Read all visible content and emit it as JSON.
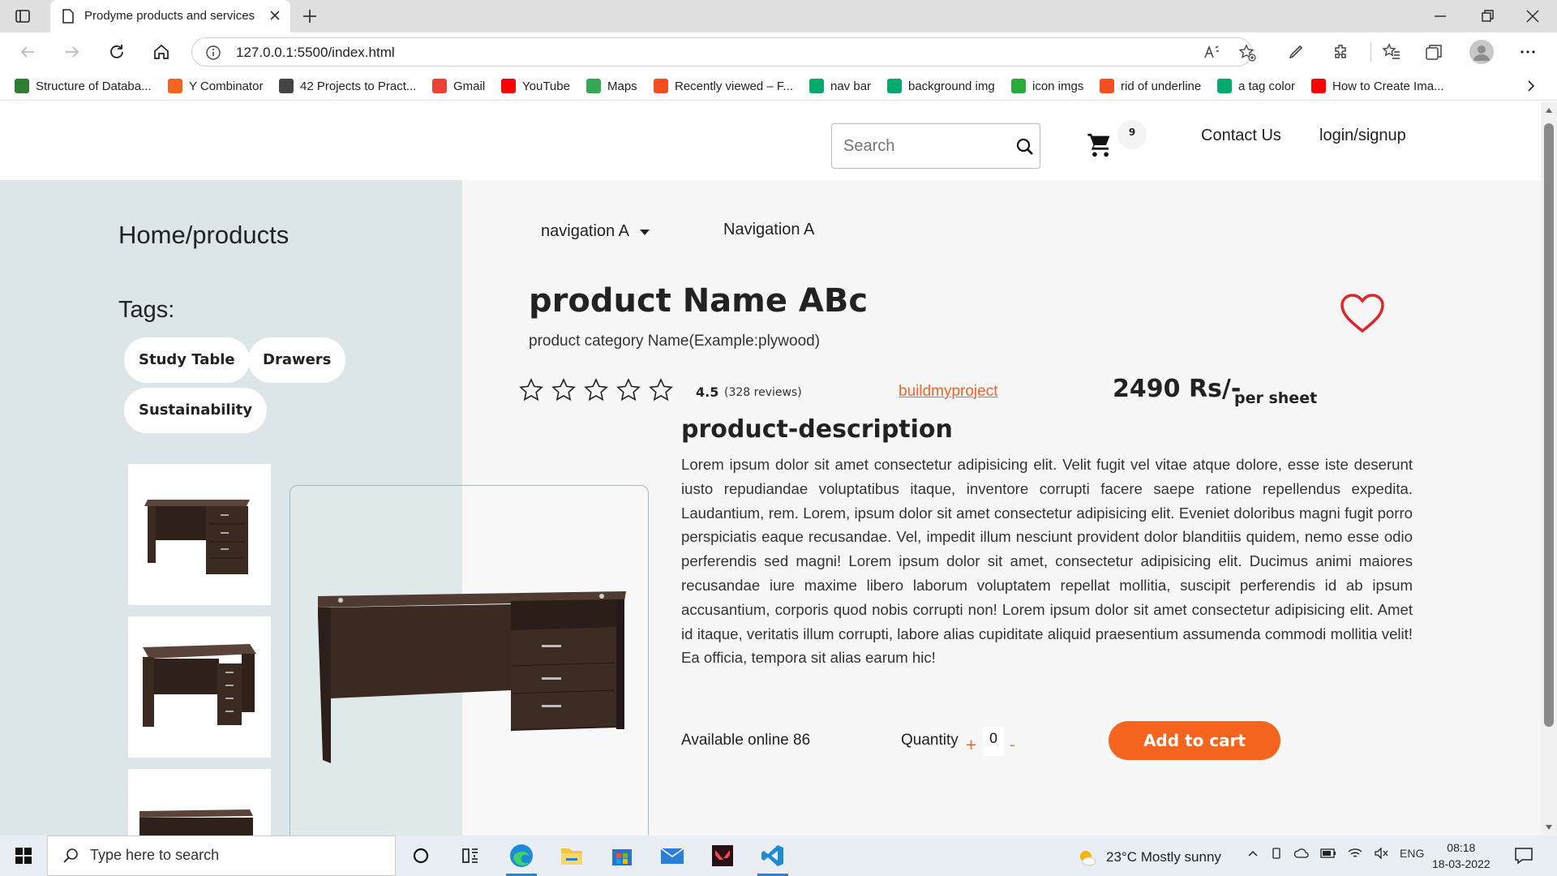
{
  "browser": {
    "tab_title": "Prodyme products and services",
    "url": "127.0.0.1:5500/index.html",
    "bookmarks": [
      {
        "label": "Structure of Databa...",
        "icon": "gg-icon",
        "color": "#2e7d32"
      },
      {
        "label": "Y Combinator",
        "icon": "y-icon",
        "color": "#f26522"
      },
      {
        "label": "42 Projects to Pract...",
        "icon": "x-circle-icon",
        "color": "#444444"
      },
      {
        "label": "Gmail",
        "icon": "gmail-icon",
        "color": "#ea4335"
      },
      {
        "label": "YouTube",
        "icon": "youtube-icon",
        "color": "#ff0000"
      },
      {
        "label": "Maps",
        "icon": "maps-icon",
        "color": "#34a853"
      },
      {
        "label": "Recently viewed – F...",
        "icon": "figma-icon",
        "color": "#f24e1e"
      },
      {
        "label": "nav bar",
        "icon": "w3-icon",
        "color": "#04aa6d"
      },
      {
        "label": "background img",
        "icon": "w3-icon",
        "color": "#04aa6d"
      },
      {
        "label": "icon imgs",
        "icon": "plus-square-icon",
        "color": "#2bab3c"
      },
      {
        "label": "rid of underline",
        "icon": "windows-icon",
        "color": "#f25022"
      },
      {
        "label": "a tag color",
        "icon": "w3-icon",
        "color": "#04aa6d"
      },
      {
        "label": "How to Create Ima...",
        "icon": "youtube-icon",
        "color": "#ff0000"
      }
    ]
  },
  "header": {
    "search_placeholder": "Search",
    "cart_count": "9",
    "contact": "Contact Us",
    "login": "login/signup"
  },
  "sidebar": {
    "breadcrumb": "Home/products",
    "tags_label": "Tags:",
    "tags": [
      "Study Table",
      "Drawers",
      "Sustainability"
    ]
  },
  "product": {
    "nav_1": "navigation A",
    "nav_2": "Navigation A",
    "name": "product Name ABc",
    "category": "product category Name(Example:plywood)",
    "rating": "4.5",
    "reviews": "(328 reviews)",
    "seller": "buildmyproject",
    "price": "2490 Rs/-",
    "unit": "per sheet",
    "desc_heading": "product-description",
    "description": "Lorem ipsum dolor sit amet consectetur adipisicing elit. Velit fugit vel vitae atque dolore, esse iste deserunt iusto repudiandae voluptatibus itaque, inventore corrupti facere saepe ratione repellendus expedita. Laudantium, rem. Lorem, ipsum dolor sit amet consectetur adipisicing elit. Eveniet doloribus magni fugit porro perspiciatis eaque recusandae. Vel, impedit illum nesciunt provident dolor blanditiis quidem, nemo esse odio perferendis sed magni! Lorem ipsum dolor sit amet, consectetur adipisicing elit. Ducimus animi maiores recusandae iure maxime libero laborum voluptatem repellat mollitia, suscipit perferendis id ab ipsum accusantium, corporis quod nobis corrupti non! Lorem ipsum dolor sit amet consectetur adipisicing elit. Amet id itaque, veritatis illum corrupti, labore alias cupiditate aliquid praesentium assumenda commodi mollitia velit! Ea officia, tempora sit alias earum hic!",
    "available": "Available online 86",
    "quantity_label": "Quantity",
    "quantity_plus": "+",
    "quantity_value": "0",
    "quantity_minus": "-",
    "add_to_cart": "Add to cart",
    "accent_color": "#f5651f"
  },
  "taskbar": {
    "search_placeholder": "Type here to search",
    "weather": "23°C  Mostly sunny",
    "language": "ENG",
    "time": "08:18",
    "date": "18-03-2022"
  }
}
